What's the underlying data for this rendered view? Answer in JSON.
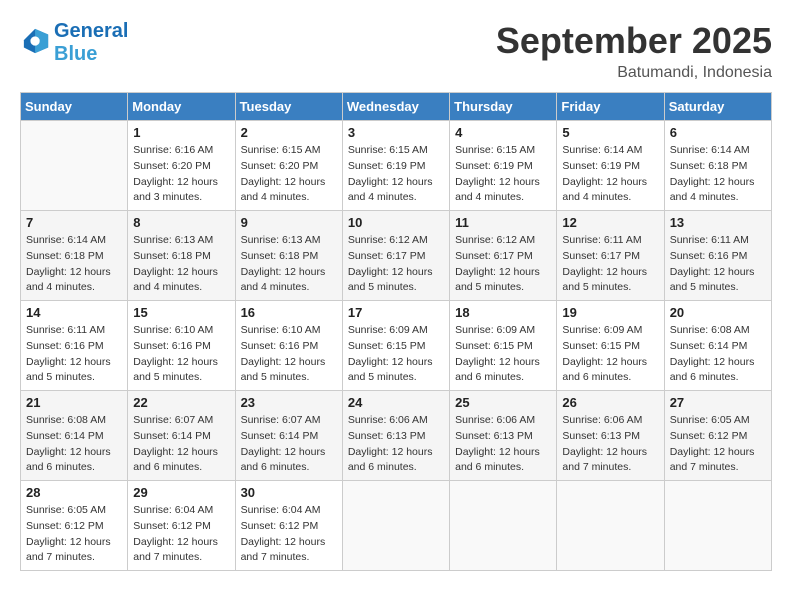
{
  "logo": {
    "line1": "General",
    "line2": "Blue"
  },
  "title": "September 2025",
  "subtitle": "Batumandi, Indonesia",
  "weekdays": [
    "Sunday",
    "Monday",
    "Tuesday",
    "Wednesday",
    "Thursday",
    "Friday",
    "Saturday"
  ],
  "weeks": [
    [
      {
        "day": null,
        "sunrise": null,
        "sunset": null,
        "daylight": null
      },
      {
        "day": "1",
        "sunrise": "Sunrise: 6:16 AM",
        "sunset": "Sunset: 6:20 PM",
        "daylight": "Daylight: 12 hours and 3 minutes."
      },
      {
        "day": "2",
        "sunrise": "Sunrise: 6:15 AM",
        "sunset": "Sunset: 6:20 PM",
        "daylight": "Daylight: 12 hours and 4 minutes."
      },
      {
        "day": "3",
        "sunrise": "Sunrise: 6:15 AM",
        "sunset": "Sunset: 6:19 PM",
        "daylight": "Daylight: 12 hours and 4 minutes."
      },
      {
        "day": "4",
        "sunrise": "Sunrise: 6:15 AM",
        "sunset": "Sunset: 6:19 PM",
        "daylight": "Daylight: 12 hours and 4 minutes."
      },
      {
        "day": "5",
        "sunrise": "Sunrise: 6:14 AM",
        "sunset": "Sunset: 6:19 PM",
        "daylight": "Daylight: 12 hours and 4 minutes."
      },
      {
        "day": "6",
        "sunrise": "Sunrise: 6:14 AM",
        "sunset": "Sunset: 6:18 PM",
        "daylight": "Daylight: 12 hours and 4 minutes."
      }
    ],
    [
      {
        "day": "7",
        "sunrise": "Sunrise: 6:14 AM",
        "sunset": "Sunset: 6:18 PM",
        "daylight": "Daylight: 12 hours and 4 minutes."
      },
      {
        "day": "8",
        "sunrise": "Sunrise: 6:13 AM",
        "sunset": "Sunset: 6:18 PM",
        "daylight": "Daylight: 12 hours and 4 minutes."
      },
      {
        "day": "9",
        "sunrise": "Sunrise: 6:13 AM",
        "sunset": "Sunset: 6:18 PM",
        "daylight": "Daylight: 12 hours and 4 minutes."
      },
      {
        "day": "10",
        "sunrise": "Sunrise: 6:12 AM",
        "sunset": "Sunset: 6:17 PM",
        "daylight": "Daylight: 12 hours and 5 minutes."
      },
      {
        "day": "11",
        "sunrise": "Sunrise: 6:12 AM",
        "sunset": "Sunset: 6:17 PM",
        "daylight": "Daylight: 12 hours and 5 minutes."
      },
      {
        "day": "12",
        "sunrise": "Sunrise: 6:11 AM",
        "sunset": "Sunset: 6:17 PM",
        "daylight": "Daylight: 12 hours and 5 minutes."
      },
      {
        "day": "13",
        "sunrise": "Sunrise: 6:11 AM",
        "sunset": "Sunset: 6:16 PM",
        "daylight": "Daylight: 12 hours and 5 minutes."
      }
    ],
    [
      {
        "day": "14",
        "sunrise": "Sunrise: 6:11 AM",
        "sunset": "Sunset: 6:16 PM",
        "daylight": "Daylight: 12 hours and 5 minutes."
      },
      {
        "day": "15",
        "sunrise": "Sunrise: 6:10 AM",
        "sunset": "Sunset: 6:16 PM",
        "daylight": "Daylight: 12 hours and 5 minutes."
      },
      {
        "day": "16",
        "sunrise": "Sunrise: 6:10 AM",
        "sunset": "Sunset: 6:16 PM",
        "daylight": "Daylight: 12 hours and 5 minutes."
      },
      {
        "day": "17",
        "sunrise": "Sunrise: 6:09 AM",
        "sunset": "Sunset: 6:15 PM",
        "daylight": "Daylight: 12 hours and 5 minutes."
      },
      {
        "day": "18",
        "sunrise": "Sunrise: 6:09 AM",
        "sunset": "Sunset: 6:15 PM",
        "daylight": "Daylight: 12 hours and 6 minutes."
      },
      {
        "day": "19",
        "sunrise": "Sunrise: 6:09 AM",
        "sunset": "Sunset: 6:15 PM",
        "daylight": "Daylight: 12 hours and 6 minutes."
      },
      {
        "day": "20",
        "sunrise": "Sunrise: 6:08 AM",
        "sunset": "Sunset: 6:14 PM",
        "daylight": "Daylight: 12 hours and 6 minutes."
      }
    ],
    [
      {
        "day": "21",
        "sunrise": "Sunrise: 6:08 AM",
        "sunset": "Sunset: 6:14 PM",
        "daylight": "Daylight: 12 hours and 6 minutes."
      },
      {
        "day": "22",
        "sunrise": "Sunrise: 6:07 AM",
        "sunset": "Sunset: 6:14 PM",
        "daylight": "Daylight: 12 hours and 6 minutes."
      },
      {
        "day": "23",
        "sunrise": "Sunrise: 6:07 AM",
        "sunset": "Sunset: 6:14 PM",
        "daylight": "Daylight: 12 hours and 6 minutes."
      },
      {
        "day": "24",
        "sunrise": "Sunrise: 6:06 AM",
        "sunset": "Sunset: 6:13 PM",
        "daylight": "Daylight: 12 hours and 6 minutes."
      },
      {
        "day": "25",
        "sunrise": "Sunrise: 6:06 AM",
        "sunset": "Sunset: 6:13 PM",
        "daylight": "Daylight: 12 hours and 6 minutes."
      },
      {
        "day": "26",
        "sunrise": "Sunrise: 6:06 AM",
        "sunset": "Sunset: 6:13 PM",
        "daylight": "Daylight: 12 hours and 7 minutes."
      },
      {
        "day": "27",
        "sunrise": "Sunrise: 6:05 AM",
        "sunset": "Sunset: 6:12 PM",
        "daylight": "Daylight: 12 hours and 7 minutes."
      }
    ],
    [
      {
        "day": "28",
        "sunrise": "Sunrise: 6:05 AM",
        "sunset": "Sunset: 6:12 PM",
        "daylight": "Daylight: 12 hours and 7 minutes."
      },
      {
        "day": "29",
        "sunrise": "Sunrise: 6:04 AM",
        "sunset": "Sunset: 6:12 PM",
        "daylight": "Daylight: 12 hours and 7 minutes."
      },
      {
        "day": "30",
        "sunrise": "Sunrise: 6:04 AM",
        "sunset": "Sunset: 6:12 PM",
        "daylight": "Daylight: 12 hours and 7 minutes."
      },
      {
        "day": null,
        "sunrise": null,
        "sunset": null,
        "daylight": null
      },
      {
        "day": null,
        "sunrise": null,
        "sunset": null,
        "daylight": null
      },
      {
        "day": null,
        "sunrise": null,
        "sunset": null,
        "daylight": null
      },
      {
        "day": null,
        "sunrise": null,
        "sunset": null,
        "daylight": null
      }
    ]
  ]
}
